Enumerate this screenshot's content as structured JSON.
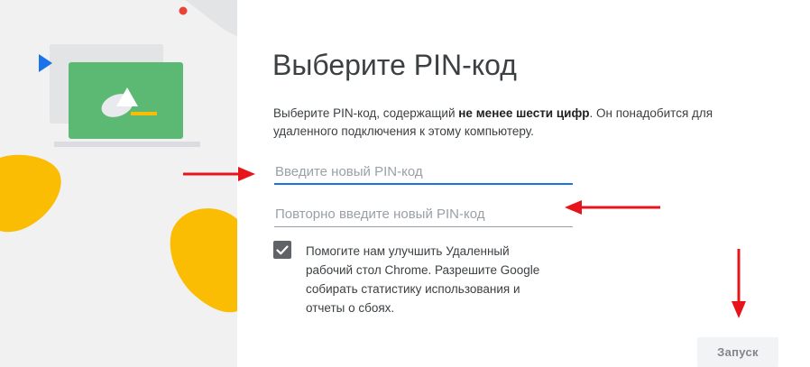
{
  "dialog": {
    "title": "Выберите PIN-код",
    "description_part1": "Выберите PIN-код, содержащий ",
    "description_bold": "не менее шести цифр",
    "description_part2": ". Он понадобится для удаленного подключения к этому компьютеру."
  },
  "pin_input": {
    "placeholder": "Введите новый PIN-код",
    "value": ""
  },
  "pin_confirm_input": {
    "placeholder": "Повторно введите новый PIN-код",
    "value": ""
  },
  "consent": {
    "checked": true,
    "label": "Помогите нам улучшить Удаленный рабочий стол Chrome. Разрешите Google собирать статистику использования и отчеты о сбоях."
  },
  "actions": {
    "launch_label": "Запуск"
  },
  "colors": {
    "accent_blue": "#1a73e8",
    "illustration_green": "#5bb974",
    "illustration_yellow": "#fbbc04",
    "annotation_red": "#e8141c"
  },
  "icons": [
    "laptop-illustration-icon",
    "checkmark-icon",
    "arrow-annotation-icon"
  ]
}
